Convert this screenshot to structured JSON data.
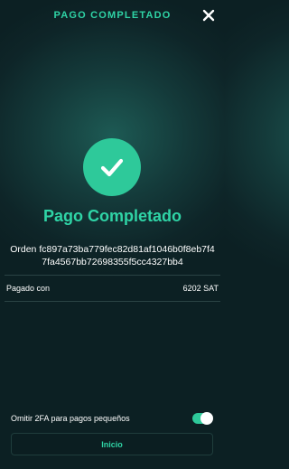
{
  "header": {
    "title": "PAGO COMPLETADO",
    "close_icon": "close-icon"
  },
  "success": {
    "icon": "checkmark-icon",
    "title": "Pago Completado",
    "order_text": "Orden fc897a73ba779fec82d81af1046b0f8eb7f47fa4567bb72698355f5cc4327bb4"
  },
  "payment": {
    "paid_label": "Pagado con",
    "paid_value": "6202 SAT"
  },
  "settings": {
    "skip_2fa_label": "Omitir 2FA para pagos pequeños",
    "skip_2fa_enabled": true
  },
  "footer": {
    "home_button_label": "Inicio"
  },
  "colors": {
    "accent": "#2fd4a6",
    "success_circle": "#2ec99a",
    "background": "#0e2528"
  }
}
